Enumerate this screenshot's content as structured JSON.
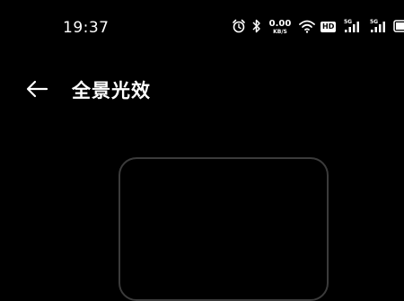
{
  "status_bar": {
    "time": "19:37",
    "network_speed_value": "0.00",
    "network_speed_unit": "KB/S",
    "hd_badge": "HD",
    "signal_1_label": "5G",
    "signal_2_label": "5G",
    "icons": [
      "alarm-icon",
      "bluetooth-icon",
      "wifi-icon",
      "hd-voice-icon",
      "signal-icon",
      "signal-icon",
      "battery-icon"
    ]
  },
  "header": {
    "title": "全景光效",
    "back_icon": "back-arrow-icon"
  },
  "colors": {
    "background": "#000000",
    "text": "#ffffff",
    "preview_border": "#3b3b3b"
  }
}
